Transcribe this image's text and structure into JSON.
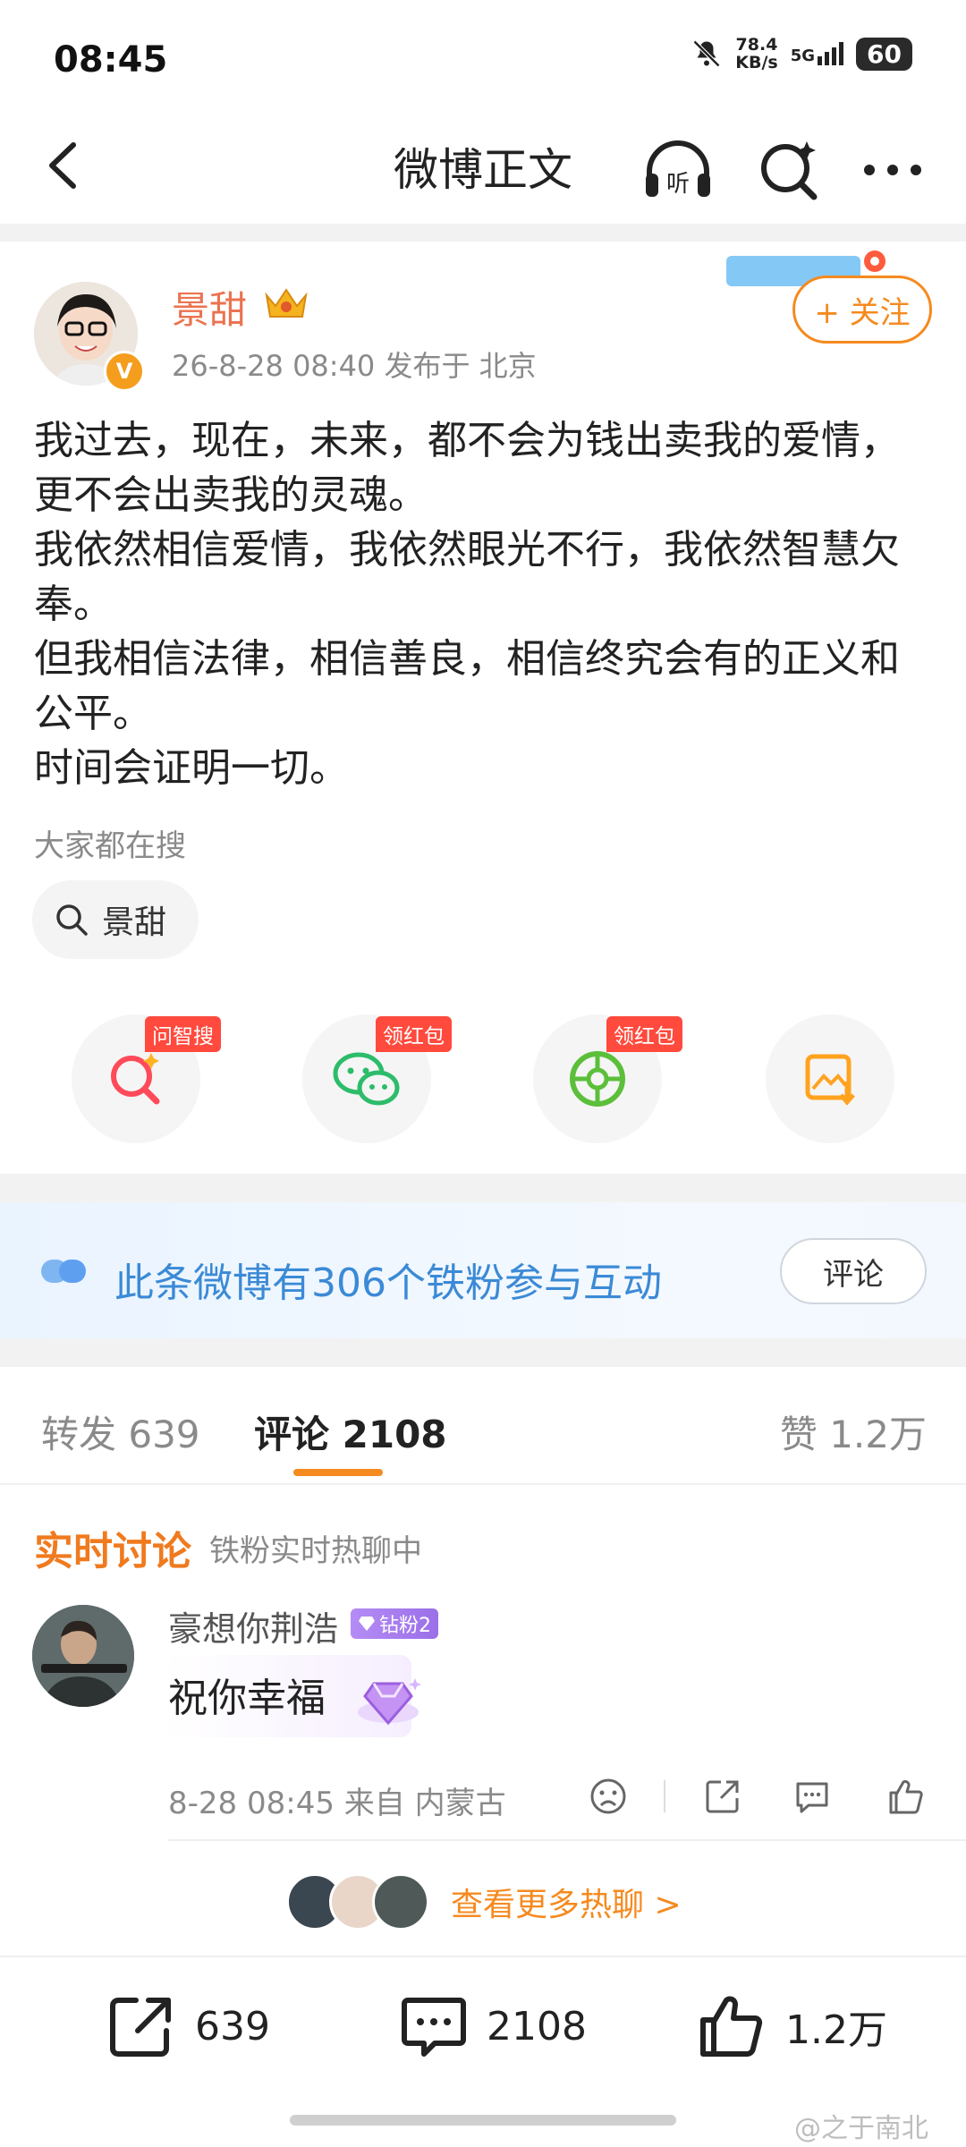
{
  "status_bar": {
    "time": "08:45",
    "speed_value": "78.4",
    "speed_unit": "KB/s",
    "network": "5G",
    "battery": "60"
  },
  "header": {
    "title": "微博正文",
    "listen_label": "听"
  },
  "post": {
    "author": "景甜",
    "meta": "26-8-28 08:40  发布于 北京",
    "follow_label": "+ 关注",
    "verified_mark": "V",
    "lines": [
      "我过去，现在，未来，都不会为钱出卖我的爱情，",
      "更不会出卖我的灵魂。",
      "我依然相信爱情，我依然眼光不行，我依然智慧欠",
      "奉。",
      "但我相信法律，相信善良，相信终究会有的正义和",
      "公平。",
      "时间会证明一切。"
    ],
    "search_hint": "大家都在搜",
    "search_chip": "景甜"
  },
  "actions": [
    {
      "icon": "ai-search-icon",
      "badge": "问智搜"
    },
    {
      "icon": "wechat-icon",
      "badge": "领红包"
    },
    {
      "icon": "moments-icon",
      "badge": "领红包"
    },
    {
      "icon": "save-image-icon",
      "badge": ""
    }
  ],
  "fans_banner": {
    "text": "此条微博有306个铁粉参与互动",
    "button": "评论"
  },
  "tabs": {
    "repost": "转发 639",
    "comment": "评论 2108",
    "like": "赞 1.2万"
  },
  "live": {
    "title": "实时讨论",
    "subtitle": "铁粉实时热聊中"
  },
  "comment": {
    "user": "豪想你荆浩",
    "badge": "钻粉2",
    "text": "祝你幸福",
    "meta": "8-28 08:45  来自 内蒙古",
    "more": "查看更多热聊 >"
  },
  "bottom_bar": {
    "repost_count": "639",
    "comment_count": "2108",
    "like_count": "1.2万"
  },
  "watermark": "@之于南北",
  "colors": {
    "accent": "#f58a1f",
    "author": "#eb7350",
    "link_blue": "#3b8ad6",
    "badge_red": "#ff4a3d"
  }
}
